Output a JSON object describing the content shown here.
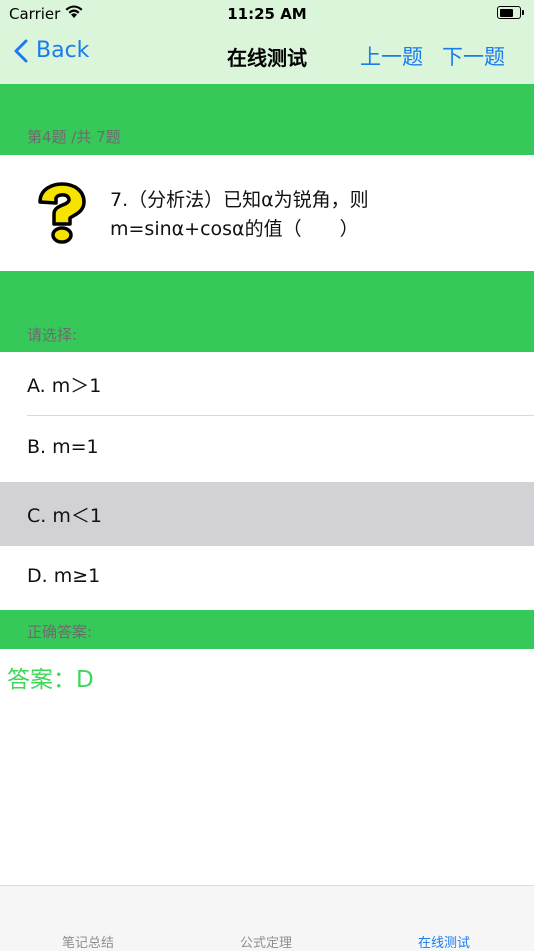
{
  "status_bar": {
    "carrier": "Carrier",
    "time": "11:25 AM"
  },
  "nav": {
    "back_label": "Back",
    "title": "在线测试",
    "prev_label": "上一题",
    "next_label": "下一题"
  },
  "progress": {
    "label": "第4题 /共 7题"
  },
  "question": {
    "line1": "7.（分析法）已知α为锐角，则",
    "line2": "m=sinα+cosα的值（　　）",
    "icon": "question-mark-icon"
  },
  "choose_label": "请选择:",
  "options": [
    {
      "label": "A.  m＞1"
    },
    {
      "label": "B.  m=1"
    },
    {
      "label": "C.  m＜1",
      "selected": true
    },
    {
      "label": "D.  m≥1"
    }
  ],
  "correct_label": "正确答案:",
  "answer_text": "答案：D",
  "tabs": [
    {
      "label": "笔记总结",
      "active": false
    },
    {
      "label": "公式定理",
      "active": false
    },
    {
      "label": "在线测试",
      "active": true
    }
  ],
  "colors": {
    "accent": "#1a7bef",
    "band": "#37c85a",
    "answer": "#3fd757",
    "selected": "#d2d2d6",
    "nav_bg": "#dbf5db"
  }
}
